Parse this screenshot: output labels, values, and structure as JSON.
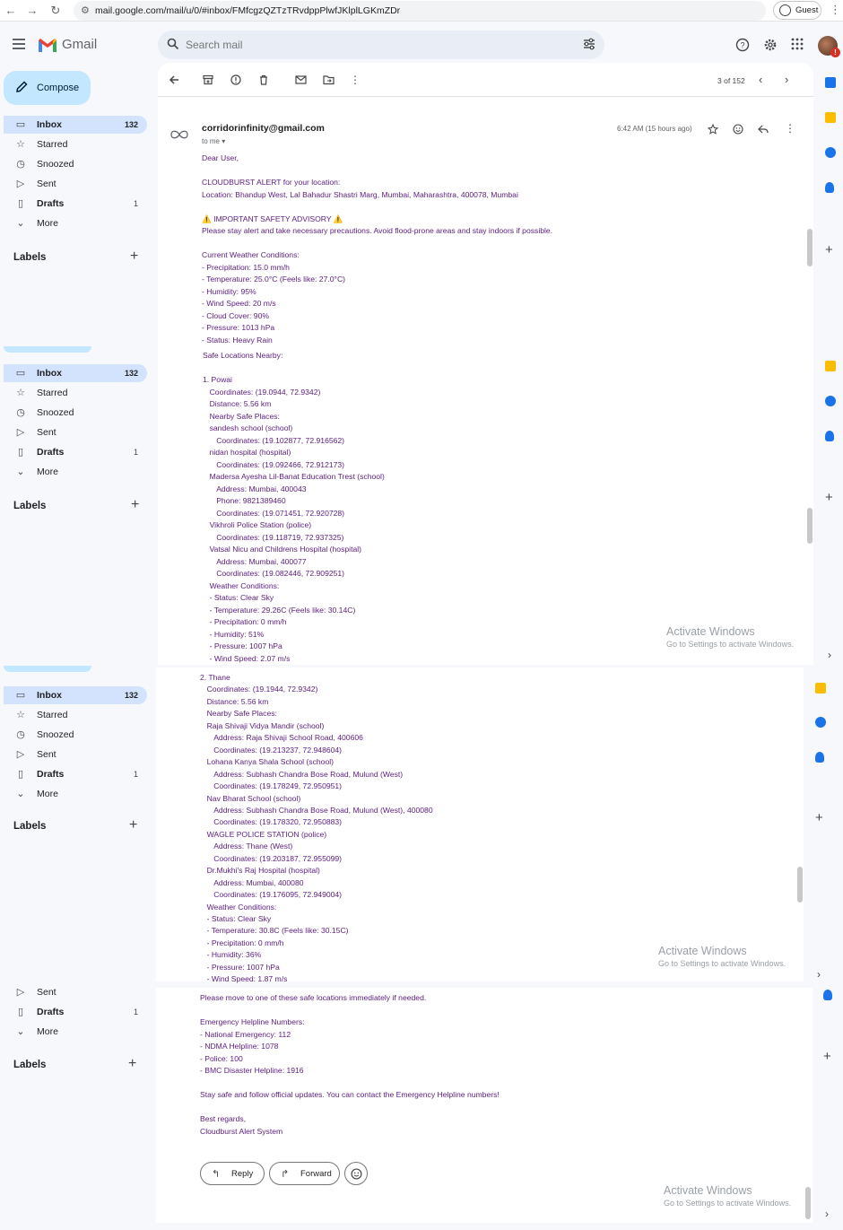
{
  "browser": {
    "url": "mail.google.com/mail/u/0/#inbox/FMfcgzQZTzTRvdppPlwfJKlplLGKmZDr",
    "profile_label": "Guest"
  },
  "app": {
    "name": "Gmail",
    "search_placeholder": "Search mail",
    "pager": "3 of 152",
    "accent": "#0b57d0",
    "active_nav_bg": "#d3e3fd",
    "compose_bg": "#c2e7ff",
    "avatar_badge": "!"
  },
  "sidebar": {
    "compose_label": "Compose",
    "labels_heading": "Labels",
    "items": [
      {
        "icon": "inbox-icon",
        "label": "Inbox",
        "count": "132"
      },
      {
        "icon": "star-icon",
        "label": "Starred",
        "count": ""
      },
      {
        "icon": "clock-icon",
        "label": "Snoozed",
        "count": ""
      },
      {
        "icon": "send-icon",
        "label": "Sent",
        "count": ""
      },
      {
        "icon": "draft-icon",
        "label": "Drafts",
        "count": "1"
      },
      {
        "icon": "chevron-down-icon",
        "label": "More",
        "count": ""
      }
    ]
  },
  "email": {
    "sender": "corridorinfinity@gmail.com",
    "to": "to me",
    "time": "6:42 AM (15 hours ago)",
    "lines1": [
      "Dear User,",
      "",
      "CLOUDBURST ALERT for your location:",
      "Location: Bhandup West, Lal Bahadur Shastri Marg, Mumbai, Maharashtra, 400078, Mumbai",
      "",
      "⚠️ IMPORTANT SAFETY ADVISORY ⚠️",
      "Please stay alert and take necessary precautions. Avoid flood-prone areas and stay indoors if possible.",
      "",
      "Current Weather Conditions:",
      "- Precipitation: 15.0 mm/h",
      "- Temperature: 25.0°C (Feels like: 27.0°C)",
      "- Humidity: 95%",
      "- Wind Speed: 20 m/s",
      "- Cloud Cover: 90%",
      "- Pressure: 1013 hPa",
      "- Status: Heavy Rain"
    ],
    "safe_heading": "Safe Locations Nearby:",
    "lines2": [
      "1. Powai",
      "  Coordinates: (19.0944, 72.9342)",
      "  Distance: 5.56 km",
      "  Nearby Safe Places:",
      "  sandesh school (school)",
      "    Coordinates: (19.102877, 72.916562)",
      "  nidan hospital (hospital)",
      "    Coordinates: (19.092466, 72.912173)",
      "  Madersa Ayesha Lil-Banat Education Trest (school)",
      "    Address: Mumbai, 400043",
      "    Phone: 9821389460",
      "    Coordinates: (19.071451, 72.920728)",
      "  Vikhroli Police Station (police)",
      "    Coordinates: (19.118719, 72.937325)",
      "  Vatsal Nicu and Childrens Hospital (hospital)",
      "    Address: Mumbai, 400077",
      "    Coordinates: (19.082446, 72.909251)",
      "  Weather Conditions:",
      "  - Status: Clear Sky",
      "  - Temperature: 29.26C (Feels like: 30.14C)",
      "  - Precipitation: 0 mm/h",
      "  - Humidity: 51%",
      "  - Pressure: 1007 hPa",
      "  - Wind Speed: 2.07 m/s"
    ],
    "lines3": [
      "2. Thane",
      "  Coordinates: (19.1944, 72.9342)",
      "  Distance: 5.56 km",
      "  Nearby Safe Places:",
      "  Raja Shivaji Vidya Mandir (school)",
      "    Address: Raja Shivaji School Road, 400606",
      "    Coordinates: (19.213237, 72.948604)",
      "  Lohana Kanya Shala School (school)",
      "    Address: Subhash Chandra Bose Road, Mulund (West)",
      "    Coordinates: (19.178249, 72.950951)",
      "  Nav Bharat School (school)",
      "    Address: Subhash Chandra Bose Road, Mulund (West), 400080",
      "    Coordinates: (19.178320, 72.950883)",
      "  WAGLE POLICE STATION (police)",
      "    Address: Thane (West)",
      "    Coordinates: (19.203187, 72.955099)",
      "  Dr.Mukhi's Raj Hospital (hospital)",
      "    Address: Mumbai, 400080",
      "    Coordinates: (19.176095, 72.949004)",
      "  Weather Conditions:",
      "  - Status: Clear Sky",
      "  - Temperature: 30.8C (Feels like: 30.15C)",
      "  - Precipitation: 0 mm/h",
      "  - Humidity: 36%",
      "  - Pressure: 1007 hPa",
      "  - Wind Speed: 1.87 m/s"
    ],
    "lines4": [
      "Please move to one of these safe locations immediately if needed.",
      "",
      "Emergency Helpline Numbers:",
      "- National Emergency: 112",
      "- NDMA Helpline: 1078",
      "- Police: 100",
      "- BMC Disaster Helpline: 1916",
      "",
      "Stay safe and follow official updates. You can contact the Emergency Helpline numbers!",
      "",
      "Best regards,",
      "Cloudburst Alert System"
    ],
    "text_color": "#5b1d7e"
  },
  "actions": {
    "reply": "Reply",
    "forward": "Forward"
  },
  "watermark": {
    "line1": "Activate Windows",
    "line2": "Go to Settings to activate Windows."
  }
}
